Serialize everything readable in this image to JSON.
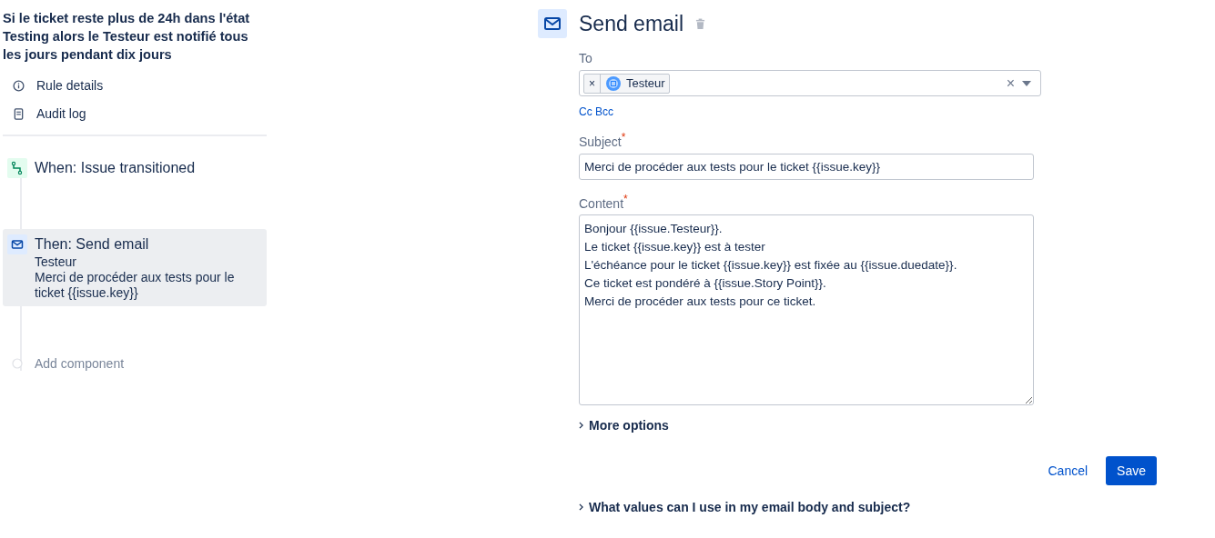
{
  "rule": {
    "title": "Si le ticket reste plus de 24h dans l'état Testing alors le Testeur est notifié tous les jours pendant dix jours",
    "links": [
      {
        "kind": "info",
        "label": "Rule details"
      },
      {
        "kind": "log",
        "label": "Audit log"
      }
    ],
    "components": [
      {
        "kind": "trigger",
        "label": "When: Issue transitioned",
        "selected": false
      },
      {
        "kind": "action",
        "label": "Then: Send email",
        "selected": true,
        "details": [
          "Testeur",
          "Merci de procéder aux tests pour le ticket {{issue.key}}"
        ]
      },
      {
        "kind": "add",
        "label": "Add component",
        "selected": false
      }
    ]
  },
  "editor": {
    "title": "Send email",
    "to": {
      "label": "To",
      "recipients": [
        {
          "remove": "×",
          "name": "Testeur"
        }
      ],
      "clear": "×"
    },
    "cc_bcc": "Cc Bcc",
    "subject": {
      "label": "Subject",
      "required": "*",
      "value": "Merci de procéder aux tests pour le ticket {{issue.key}}"
    },
    "content": {
      "label": "Content",
      "required": "*",
      "lines": [
        "Bonjour {{issue.Testeur}}.",
        "Le ticket {{issue.key}} est à tester",
        "L'échéance pour le ticket {{issue.key}} est fixée au {{issue.duedate}}.",
        "Ce ticket est pondéré à {{issue.Story Point}}.",
        "Merci de procéder aux tests pour ce ticket."
      ]
    },
    "more_options": {
      "label": "More options",
      "expanded": false
    },
    "buttons": [
      {
        "kind": "link",
        "label": "Cancel"
      },
      {
        "kind": "primary",
        "label": "Save"
      }
    ],
    "help": {
      "label": "What values can I use in my email body and subject?",
      "expanded": false
    }
  }
}
